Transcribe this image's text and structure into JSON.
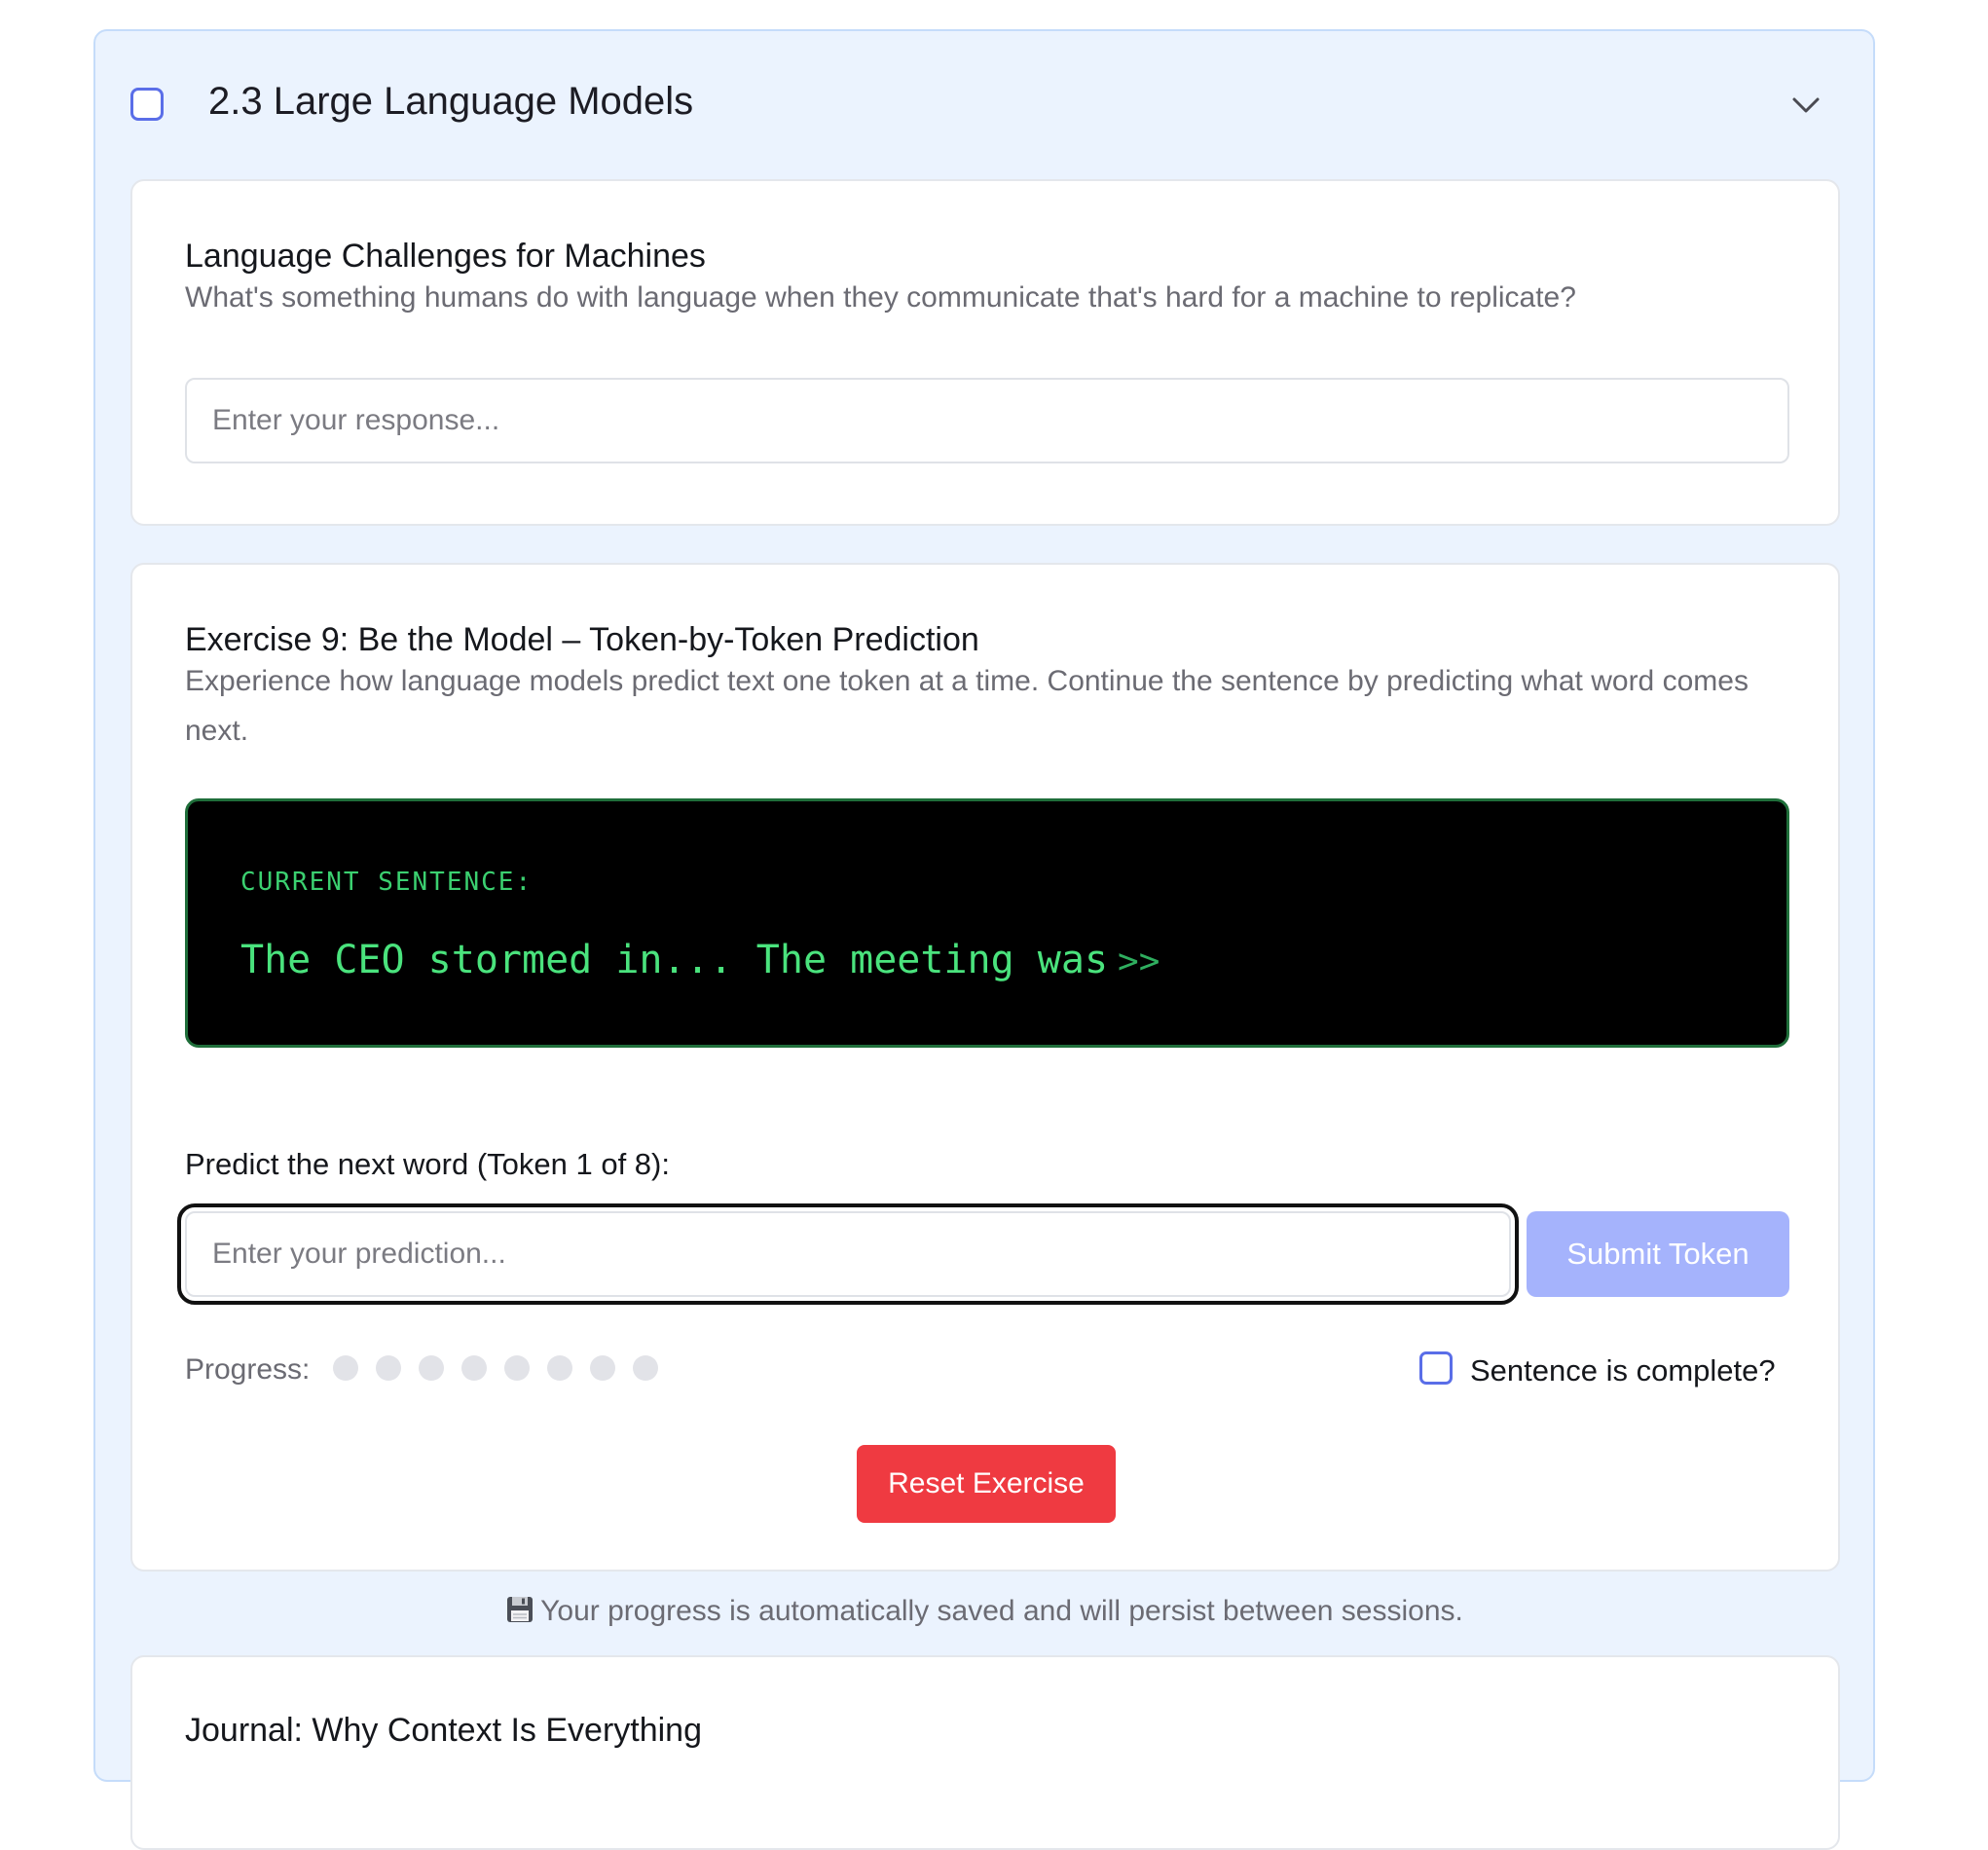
{
  "section": {
    "title": "2.3 Large Language Models",
    "checked": false,
    "expanded": true
  },
  "card1": {
    "title": "Language Challenges for Machines",
    "description": "What's something humans do with language when they communicate that's hard for a machine to replicate?",
    "input_placeholder": "Enter your response...",
    "input_value": ""
  },
  "exercise": {
    "title": "Exercise 9: Be the Model – Token-by-Token Prediction",
    "description": "Experience how language models predict text one token at a time. Continue the sentence by predicting what word comes next.",
    "terminal_label": "CURRENT SENTENCE:",
    "sentence": "The CEO stormed in... The meeting was",
    "cursor": ">>",
    "predict_label": "Predict the next word (Token 1 of 8):",
    "predict_placeholder": "Enter your prediction...",
    "predict_value": "",
    "submit_label": "Submit Token",
    "progress_label": "Progress:",
    "progress_total": 8,
    "progress_filled": 0,
    "complete_label": "Sentence is complete?",
    "complete_checked": false,
    "reset_label": "Reset Exercise"
  },
  "save_note": "Your progress is automatically saved and will persist between sessions.",
  "journal": {
    "title": "Journal: Why Context Is Everything"
  },
  "colors": {
    "section_bg": "#ebf3fe",
    "accent": "#5a6ee8",
    "terminal_text": "#4ae37d",
    "submit_disabled": "#a5b3fc",
    "reset": "#ef3a41"
  },
  "icons": {
    "section_toggle": "chevron-down-icon",
    "save": "floppy-disk-icon"
  }
}
